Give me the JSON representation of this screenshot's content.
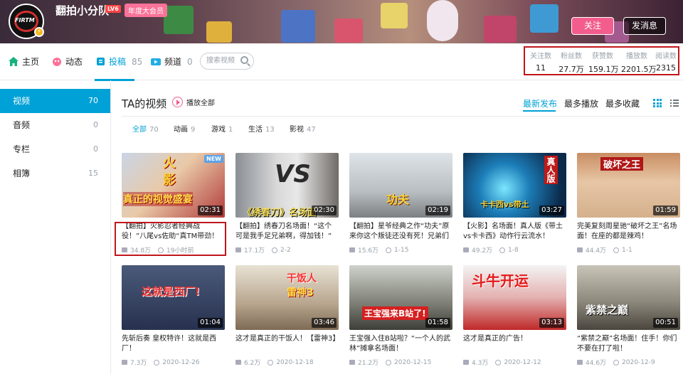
{
  "header": {
    "username": "翻拍小分队",
    "level_badge": "LV6",
    "vip_badge": "年度大会员",
    "follow_label": "关注",
    "message_label": "发消息",
    "avatar_logo_text": "FIRTM"
  },
  "nav": {
    "tabs": [
      {
        "label": "主页",
        "count": ""
      },
      {
        "label": "动态",
        "count": ""
      },
      {
        "label": "投稿",
        "count": "85"
      },
      {
        "label": "频道",
        "count": "0"
      }
    ],
    "active_tab": "投稿",
    "search_placeholder": "搜索视频"
  },
  "stats": [
    {
      "label": "关注数",
      "value": "11"
    },
    {
      "label": "粉丝数",
      "value": "27.7万"
    },
    {
      "label": "获赞数",
      "value": "159.1万"
    },
    {
      "label": "播放数",
      "value": "2201.5万"
    },
    {
      "label": "阅读数",
      "value": "2315"
    }
  ],
  "sidebar": {
    "items": [
      {
        "label": "视频",
        "count": "70"
      },
      {
        "label": "音频",
        "count": "0"
      },
      {
        "label": "专栏",
        "count": "0"
      },
      {
        "label": "相簿",
        "count": "15"
      }
    ],
    "active": "视频"
  },
  "main": {
    "title": "TA的视频",
    "play_all": "播放全部",
    "sort_options": [
      "最新发布",
      "最多播放",
      "最多收藏"
    ],
    "active_sort": "最新发布",
    "filters": [
      {
        "label": "全部",
        "count": "70"
      },
      {
        "label": "动画",
        "count": "9"
      },
      {
        "label": "游戏",
        "count": "1"
      },
      {
        "label": "生活",
        "count": "13"
      },
      {
        "label": "影视",
        "count": "47"
      }
    ],
    "active_filter": "全部"
  },
  "videos": [
    {
      "title": "【翻拍】火影忍者经典战役！”八尾vs佐助“真TM带劲！",
      "duration": "02:31",
      "views": "34.8万",
      "date": "19小时前",
      "badge": "NEW",
      "overlay": "火影 真正的视觉盛宴"
    },
    {
      "title": "【翻拍】绣春刀名场面！“这个可是我手足兄弟啊，得加钱！”",
      "duration": "02:30",
      "views": "17.1万",
      "date": "2-2",
      "overlay": "《绣春刀》名场面"
    },
    {
      "title": "【翻拍】星爷经典之作“功夫”原来你这个叛徒还没有死！兄弟们砍",
      "duration": "02:19",
      "views": "15.6万",
      "date": "1-15",
      "overlay": "功夫"
    },
    {
      "title": "【火影】名场面！真人版《带土vs卡卡西》动作行云流水！",
      "duration": "03:27",
      "views": "49.2万",
      "date": "1-8",
      "overlay": "真人版 卡卡西vs带土"
    },
    {
      "title": "完美复刻周星驰“破坏之王”名场面！在座的都是辣鸡！",
      "duration": "01:59",
      "views": "44.4万",
      "date": "1-1",
      "overlay": "破坏之王"
    },
    {
      "title": "先斩后奏 皇权特许！这就是西厂！",
      "duration": "01:04",
      "views": "7.3万",
      "date": "2020-12-26",
      "overlay": "这就是西厂"
    },
    {
      "title": "这才是真正的干饭人！【雷神3】",
      "duration": "03:46",
      "views": "6.2万",
      "date": "2020-12-18",
      "overlay": "干饭人 雷神3"
    },
    {
      "title": "王宝强入住B站啦？“一个人的武林”摊拿名场面！",
      "duration": "01:58",
      "views": "21.2万",
      "date": "2020-12-15",
      "overlay": "王宝强来B站了!"
    },
    {
      "title": "这才是真正的广告！",
      "duration": "03:13",
      "views": "4.3万",
      "date": "2020-12-12",
      "overlay": "斗牛开运"
    },
    {
      "title": "“紫禁之巅”名场面！住手！你们不要在打了啦！",
      "duration": "00:51",
      "views": "44.6万",
      "date": "2020-12-9",
      "overlay": "紫禁之巅"
    }
  ],
  "colors": {
    "accent": "#00a1d6",
    "pink": "#f25d8e",
    "highlight_box": "#c0161b"
  }
}
